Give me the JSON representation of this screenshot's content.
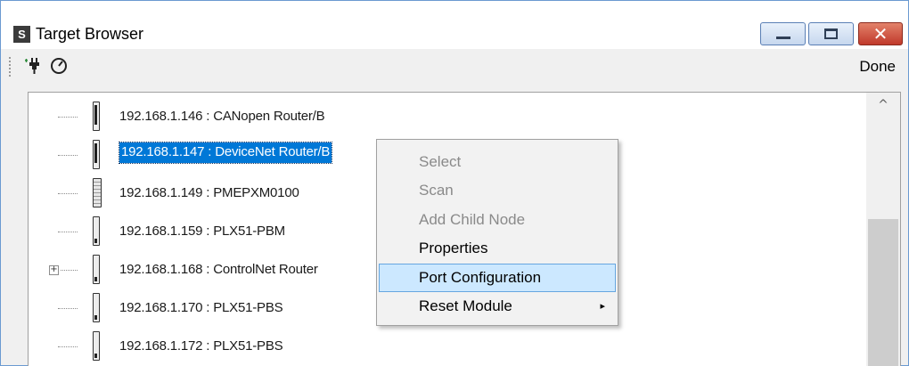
{
  "window": {
    "app_icon_letter": "S",
    "title": "Target Browser",
    "controls": {
      "minimize": "minimize",
      "maximize": "maximize",
      "close": "✕"
    }
  },
  "toolbar": {
    "icons": [
      "connect-plug-icon",
      "gauge-icon"
    ],
    "done_label": "Done"
  },
  "tree": {
    "nodes": [
      {
        "label": "192.168.1.146 : CANopen Router/B",
        "icon": "module-narrow"
      },
      {
        "label": "192.168.1.147 : DeviceNet Router/B",
        "icon": "module-narrow",
        "selected": true
      },
      {
        "label": "192.168.1.149 : PMEPXM0100",
        "icon": "module-wide"
      },
      {
        "label": "192.168.1.159 : PLX51-PBM",
        "icon": "module-narrow"
      },
      {
        "label": "192.168.1.168 : ControlNet Router",
        "icon": "module-narrow",
        "expander": "+"
      },
      {
        "label": "192.168.1.170 : PLX51-PBS",
        "icon": "module-narrow"
      },
      {
        "label": "192.168.1.172 : PLX51-PBS",
        "icon": "module-narrow"
      }
    ]
  },
  "scrollbar": {
    "up_arrow": "^"
  },
  "context_menu": {
    "items": [
      {
        "label": "Select",
        "enabled": false
      },
      {
        "label": "Scan",
        "enabled": false
      },
      {
        "label": "Add Child Node",
        "enabled": false
      },
      {
        "label": "Properties",
        "enabled": true
      },
      {
        "label": "Port Configuration",
        "enabled": true,
        "highlighted": true
      },
      {
        "label": "Reset Module",
        "enabled": true,
        "submenu": "▸"
      }
    ]
  },
  "colors": {
    "selection": "#0078d7",
    "menu_highlight": "#cce8ff",
    "close_button": "#c0392b",
    "disabled_text": "#8a8a8a"
  }
}
